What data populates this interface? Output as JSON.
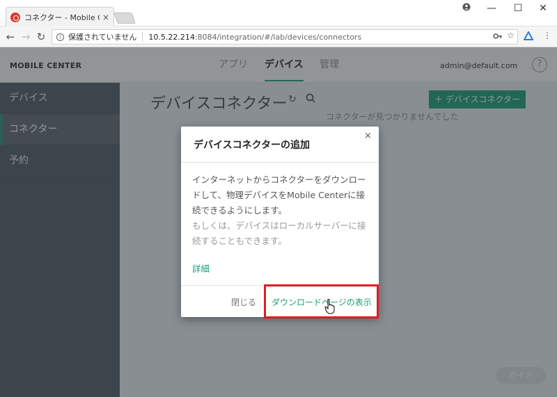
{
  "browser": {
    "tab_title": "コネクター - Mobile Center",
    "tab_close": "×",
    "url_security": "保護されていません",
    "url_host": "10.5.22.214",
    "url_path": ":8084/integration/#/lab/devices/connectors"
  },
  "app": {
    "brand": "MOBILE CENTER",
    "nav": [
      "アプリ",
      "デバイス",
      "管理"
    ],
    "active_nav": "デバイス",
    "user": "admin@default.com",
    "help": "?"
  },
  "sidebar": {
    "items": [
      {
        "label": "デバイス"
      },
      {
        "label": "コネクター"
      },
      {
        "label": "予約"
      }
    ],
    "active": "コネクター"
  },
  "main": {
    "title": "デバイスコネクター",
    "add_button": "＋ デバイスコネクター",
    "empty_message": "コネクターが見つかりませんでした",
    "guide_button": "ガイド"
  },
  "dialog": {
    "title": "デバイスコネクターの追加",
    "close": "×",
    "body1": "インターネットからコネクターをダウンロードして、物理デバイスをMobile Centerに接続できるようにします。",
    "body2": "もしくは、デバイスはローカルサーバーに接続することもできます。",
    "link": "詳細",
    "close_button": "閉じる",
    "download_button": "ダウンロードページの表示"
  },
  "colors": {
    "accent": "#1b9e77",
    "highlight": "#e01b24",
    "sidebar": "#535b62"
  }
}
